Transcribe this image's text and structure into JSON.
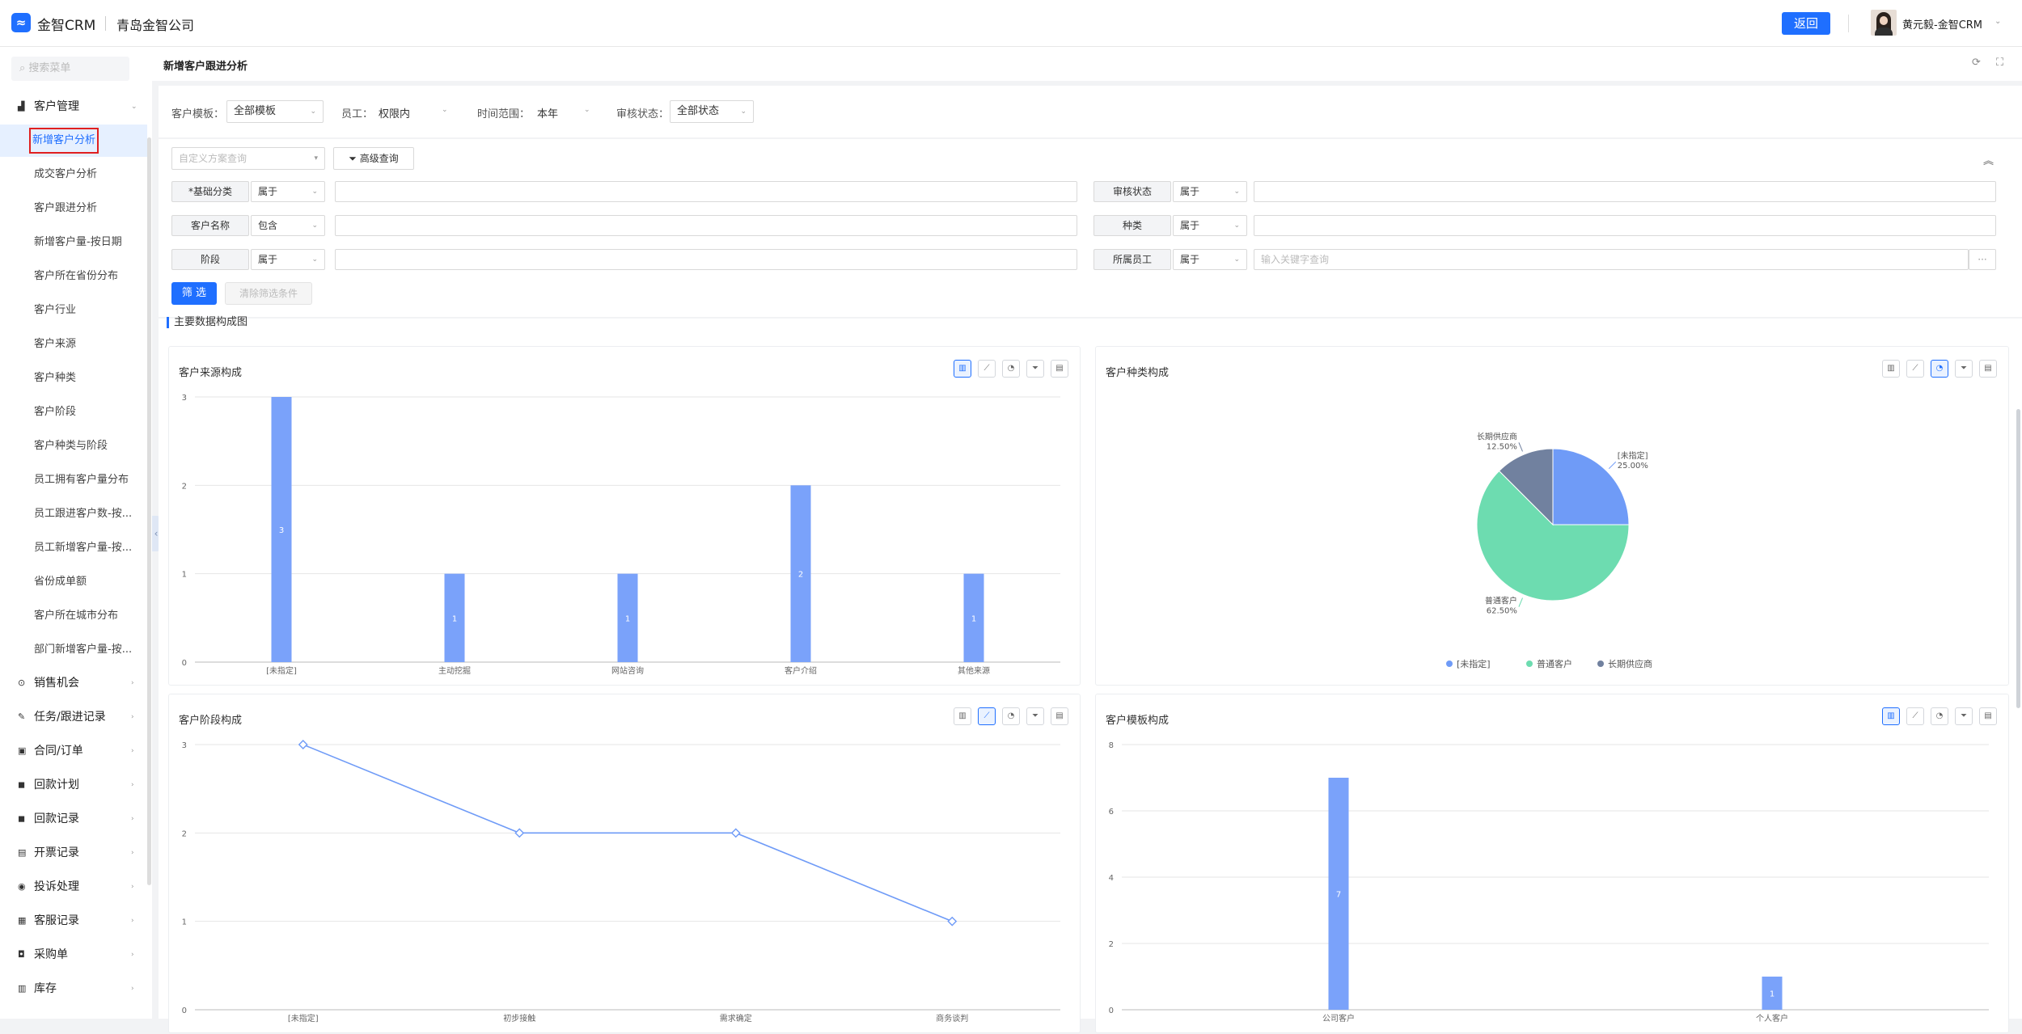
{
  "app": {
    "logo_mark": "≈",
    "logo_text": "金智CRM",
    "company": "青岛金智公司",
    "back_label": "返回",
    "user_name": "黄元毅-金智CRM",
    "user_caret": "⌄"
  },
  "sidebar": {
    "search_placeholder": "搜索菜单",
    "group_customer": {
      "icon": "▟",
      "label": "客户管理",
      "caret": "⌄"
    },
    "items": [
      "新增客户分析",
      "成交客户分析",
      "客户跟进分析",
      "新增客户量-按日期",
      "客户所在省份分布",
      "客户行业",
      "客户来源",
      "客户种类",
      "客户阶段",
      "客户种类与阶段",
      "员工拥有客户量分布",
      "员工跟进客户数-按...",
      "员工新增客户量-按...",
      "省份成单额",
      "客户所在城市分布",
      "部门新增客户量-按..."
    ],
    "groups": [
      {
        "icon": "⊙",
        "label": "销售机会",
        "caret": "›"
      },
      {
        "icon": "✎",
        "label": "任务/跟进记录",
        "caret": "›"
      },
      {
        "icon": "▣",
        "label": "合同/订单",
        "caret": "›"
      },
      {
        "icon": "◼",
        "label": "回款计划",
        "caret": "›"
      },
      {
        "icon": "◼",
        "label": "回款记录",
        "caret": "›"
      },
      {
        "icon": "▤",
        "label": "开票记录",
        "caret": "›"
      },
      {
        "icon": "◉",
        "label": "投诉处理",
        "caret": "›"
      },
      {
        "icon": "▦",
        "label": "客服记录",
        "caret": "›"
      },
      {
        "icon": "◘",
        "label": "采购单",
        "caret": "›"
      },
      {
        "icon": "▥",
        "label": "库存",
        "caret": "›"
      }
    ],
    "collapse": "‹"
  },
  "page": {
    "title": "新增客户跟进分析",
    "refresh": "⟳",
    "fullscreen": "⛶"
  },
  "filters": {
    "template_label": "客户模板：",
    "template_value": "全部模板",
    "staff_label": "员工：",
    "staff_value": "权限内",
    "range_label": "时间范围：",
    "range_value": "本年",
    "audit_label": "审核状态：",
    "audit_value": "全部状态",
    "caret": "⌄"
  },
  "advanced": {
    "scheme_placeholder": "自定义方案查询",
    "scheme_caret": "▾",
    "adv_label": "高级查询",
    "adv_icon": "⏷",
    "collapse_icon": "︽",
    "rows": [
      {
        "label": "*基础分类",
        "op": "属于",
        "label2": "审核状态",
        "op2": "属于",
        "placeholder2": ""
      },
      {
        "label": "客户名称",
        "op": "包含",
        "label2": "种类",
        "op2": "属于",
        "placeholder2": ""
      },
      {
        "label": "阶段",
        "op": "属于",
        "label2": "所属员工",
        "op2": "属于",
        "placeholder2": "输入关键字查询"
      }
    ],
    "more": "···",
    "filter_btn": "筛 选",
    "clear_btn": "清除筛选条件"
  },
  "section_title": "主要数据构成图",
  "toolbar_icons": [
    "bar-icon",
    "line-icon",
    "pie-icon",
    "filter-icon",
    "table-icon"
  ],
  "toolbar_glyphs": [
    "▥",
    "⟋",
    "◔",
    "⏷",
    "▤"
  ],
  "charts": {
    "source": {
      "title": "客户来源构成"
    },
    "kind": {
      "title": "客户种类构成"
    },
    "stage": {
      "title": "客户阶段构成"
    },
    "template": {
      "title": "客户模板构成"
    }
  },
  "chart_data": [
    {
      "type": "bar",
      "title": "客户来源构成",
      "categories": [
        "[未指定]",
        "主动挖掘",
        "网站咨询",
        "客户介绍",
        "其他来源"
      ],
      "values": [
        3,
        1,
        1,
        2,
        1
      ],
      "ylim": [
        0,
        3
      ],
      "yticks": [
        0,
        1,
        2,
        3
      ],
      "grid": true,
      "color": "#7aa2fa"
    },
    {
      "type": "pie",
      "title": "客户种类构成",
      "slices": [
        {
          "name": "[未指定]",
          "value": 25.0,
          "label": "25.00%",
          "color": "#6f9bf7"
        },
        {
          "name": "普通客户",
          "value": 62.5,
          "label": "62.50%",
          "color": "#6ddcb0"
        },
        {
          "name": "长期供应商",
          "value": 12.5,
          "label": "12.50%",
          "color": "#71819f"
        }
      ],
      "legend": "bottom"
    },
    {
      "type": "line",
      "title": "客户阶段构成",
      "categories": [
        "[未指定]",
        "初步接触",
        "需求确定",
        "商务谈判"
      ],
      "values": [
        3,
        2,
        2,
        1
      ],
      "ylim": [
        0,
        3
      ],
      "yticks": [
        0,
        1,
        2,
        3
      ],
      "grid": true,
      "color": "#6f9bf7"
    },
    {
      "type": "bar",
      "title": "客户模板构成",
      "categories": [
        "公司客户",
        "个人客户"
      ],
      "values": [
        7,
        1
      ],
      "ylim": [
        0,
        8
      ],
      "yticks": [
        0,
        2,
        4,
        6,
        8
      ],
      "grid": true,
      "color": "#7aa2fa"
    }
  ]
}
